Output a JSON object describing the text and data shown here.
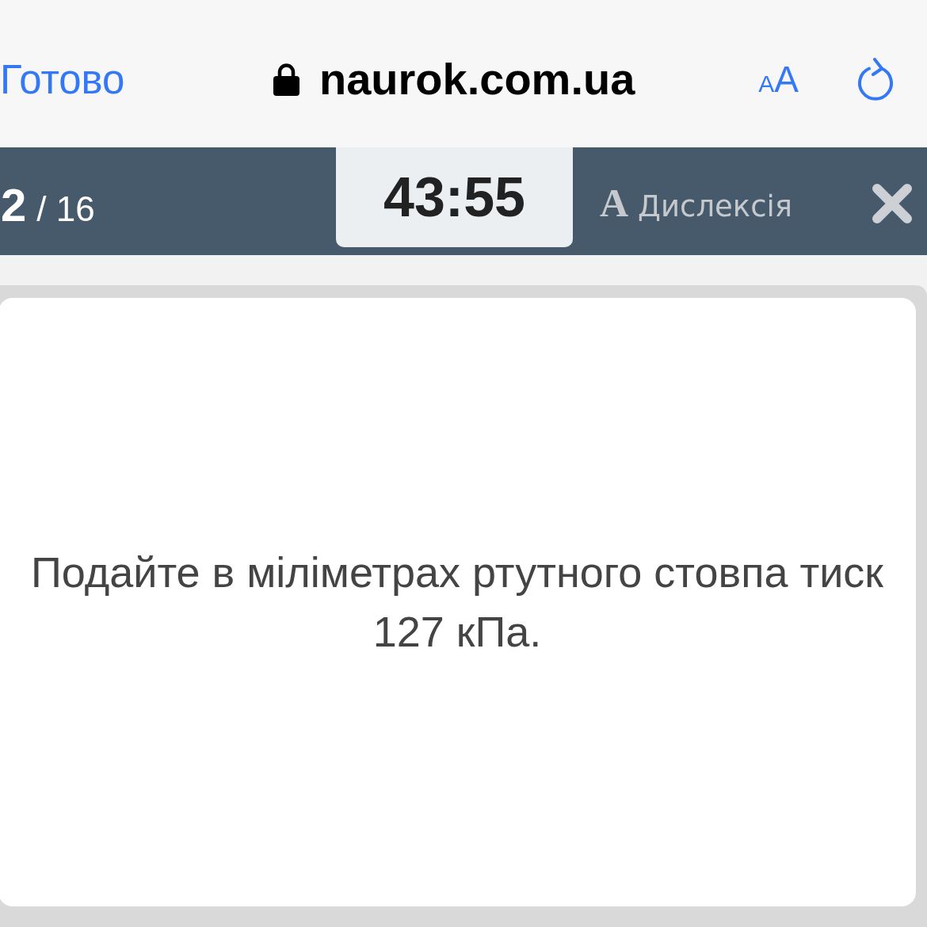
{
  "browser_bar": {
    "done_label": "Готово",
    "domain": "naurok.com.ua",
    "text_size": {
      "small_letter": "A",
      "large_letter": "A"
    }
  },
  "quiz_header": {
    "counter": {
      "current": "2",
      "total": "/ 16"
    },
    "timer": "43:55",
    "dyslexia_button": {
      "letter": "A",
      "label": "Дислексія"
    }
  },
  "question": {
    "text": "Подайте в міліметрах ртутного стовпа тиск 127 кПа."
  }
}
